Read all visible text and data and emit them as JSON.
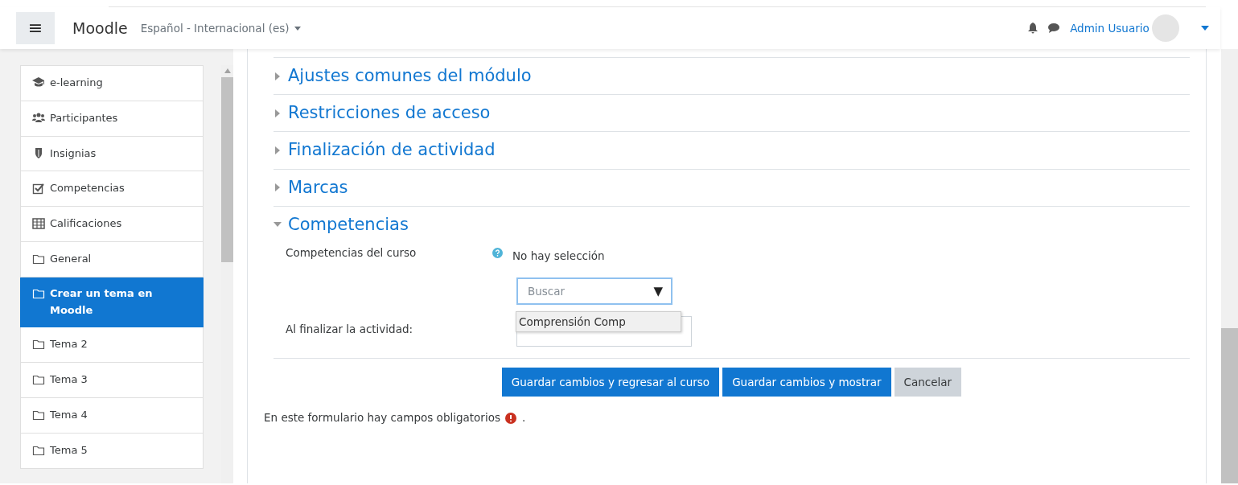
{
  "navbar": {
    "menu_toggle": "≡",
    "brand": "Moodle",
    "language": "Español - Internacional (es)",
    "user_name": "Admin Usuario"
  },
  "sidebar": {
    "items": [
      {
        "kind": "course",
        "label": "e-learning",
        "selected": false
      },
      {
        "kind": "participants",
        "label": "Participantes",
        "selected": false
      },
      {
        "kind": "badges",
        "label": "Insignias",
        "selected": false
      },
      {
        "kind": "competencies",
        "label": "Competencias",
        "selected": false
      },
      {
        "kind": "grades",
        "label": "Calificaciones",
        "selected": false
      },
      {
        "kind": "section",
        "label": "General",
        "selected": false
      },
      {
        "kind": "section",
        "label": "Crear un tema en Moodle",
        "selected": true
      },
      {
        "kind": "section",
        "label": "Tema 2",
        "selected": false
      },
      {
        "kind": "section",
        "label": "Tema 3",
        "selected": false
      },
      {
        "kind": "section",
        "label": "Tema 4",
        "selected": false
      },
      {
        "kind": "section",
        "label": "Tema 5",
        "selected": false
      }
    ]
  },
  "sections": [
    {
      "title": "Ajustes comunes del módulo",
      "expanded": false
    },
    {
      "title": "Restricciones de acceso",
      "expanded": false
    },
    {
      "title": "Finalización de actividad",
      "expanded": false
    },
    {
      "title": "Marcas",
      "expanded": false
    },
    {
      "title": "Competencias",
      "expanded": true
    }
  ],
  "competencies": {
    "course_label": "Competencias del curso",
    "selection": "No hay selección",
    "search": {
      "placeholder": "Buscar",
      "arrow": "▼"
    },
    "suggestion": "Comprensión Comp",
    "completion_label": "Al finalizar la actividad:"
  },
  "buttons": [
    {
      "label": "Guardar cambios y regresar al curso",
      "kind": "primary"
    },
    {
      "label": "Guardar cambios y mostrar",
      "kind": "primary"
    },
    {
      "label": "Cancelar",
      "kind": "secondary"
    }
  ],
  "required_note": {
    "text": "En este formulario hay campos obligatorios",
    "suffix": "."
  }
}
